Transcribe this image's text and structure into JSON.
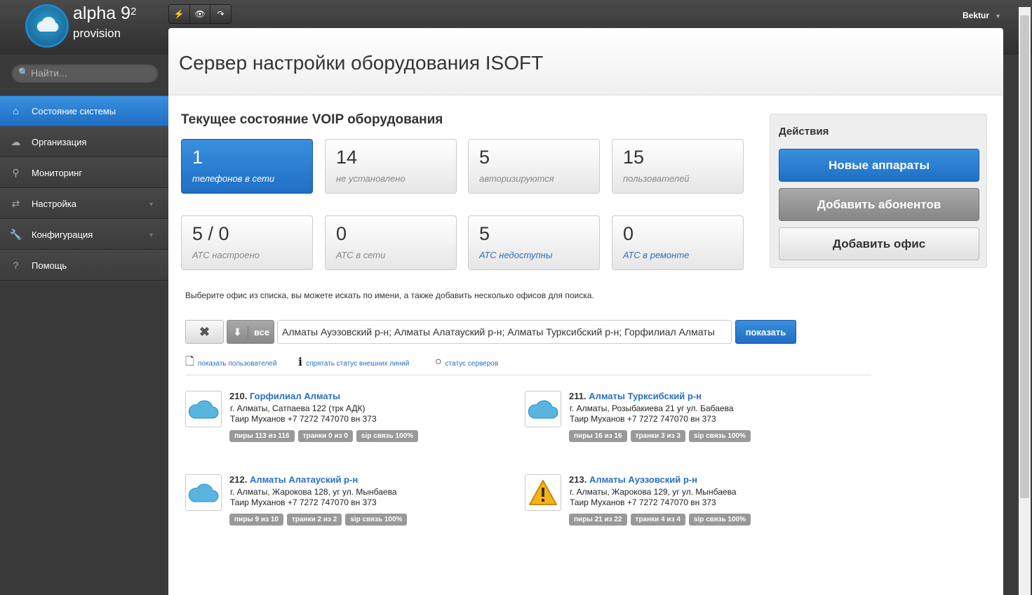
{
  "app": {
    "logo_text": "alpha 9",
    "logo_sup": "2",
    "logo_sub": "provision",
    "user": "Bektur"
  },
  "toolbar": {
    "icons": [
      "bolt-icon",
      "eye-icon",
      "redo-icon"
    ]
  },
  "search": {
    "placeholder": "Найти..."
  },
  "sidebar": {
    "items": [
      {
        "label": "Состояние системы",
        "icon": "home-icon",
        "active": true
      },
      {
        "label": "Организация",
        "icon": "cloud-icon"
      },
      {
        "label": "Мониторинг",
        "icon": "map-pin-icon"
      },
      {
        "label": "Настройка",
        "icon": "refresh-icon",
        "has_submenu": true
      },
      {
        "label": "Конфигурация",
        "icon": "wrench-icon",
        "has_submenu": true
      },
      {
        "label": "Помощь",
        "icon": "question-icon"
      }
    ]
  },
  "page": {
    "title": "Сервер настройки оборудования ISOFT",
    "section_title": "Текущее состояние VOIP оборудования"
  },
  "tiles": [
    {
      "value": "1",
      "label": "телефонов в сети"
    },
    {
      "value": "14",
      "label": "не установлено"
    },
    {
      "value": "5",
      "label": "авторизируются"
    },
    {
      "value": "15",
      "label": "пользователей"
    },
    {
      "value": "5 / 0",
      "label": "АТС настроено"
    },
    {
      "value": "0",
      "label": "АТС в сети"
    },
    {
      "value": "5",
      "label": "АТС недоступны"
    },
    {
      "value": "0",
      "label": "АТС в ремонте"
    }
  ],
  "actions": {
    "title": "Действия",
    "new_devices": "Новые аппараты",
    "add_subscribers": "Добавить абонентов",
    "add_office": "Добавить офис"
  },
  "filter": {
    "hint": "Выберите офис из списка, вы можете искать по имени, а также добавить несколько офисов для поиска.",
    "all_label": "все",
    "input_value": "Алматы Ауэзовский р-н; Алматы Алатауский р-н; Алматы Турксибский р-н; Горфилиал Алматы",
    "show_label": "показать",
    "links": [
      "показать пользователей",
      "спрятать статус внешних линий",
      "статус серверов"
    ]
  },
  "offices": [
    {
      "number": "210.",
      "name": "Горфилиал Алматы",
      "address": "г. Алматы, Сатпаева 122 (трк АДК)",
      "contact": "Таир Муханов +7 7272 747070 вн 373",
      "status": "ok",
      "badges": [
        "пиры 113 из 116",
        "транки 0 из 0",
        "sip связь 100%"
      ]
    },
    {
      "number": "211.",
      "name": "Алматы Турксибский р-н",
      "address": "г. Алматы, Розыбакиева 21 уг ул. Бабаева",
      "contact": "Таир Муханов +7 7272 747070 вн 373",
      "status": "ok",
      "badges": [
        "пиры 16 из 16",
        "транки 3 из 3",
        "sip связь 100%"
      ]
    },
    {
      "number": "212.",
      "name": "Алматы Алатауский р-н",
      "address": "г. Алматы, Жарокова 128, уг ул. Мынбаева",
      "contact": "Таир Муханов +7 7272 747070 вн 373",
      "status": "ok",
      "badges": [
        "пиры 9 из 10",
        "транки 2 из 2",
        "sip связь 100%"
      ]
    },
    {
      "number": "213.",
      "name": "Алматы Ауэзовский р-н",
      "address": "г. Алматы, Жарокова 129, уг ул. Мынбаева",
      "contact": "Таир Муханов +7 7272 747070 вн 373",
      "status": "warning",
      "badges": [
        "пиры 21 из 22",
        "транки 4 из 4",
        "sip связь 100%"
      ]
    }
  ]
}
